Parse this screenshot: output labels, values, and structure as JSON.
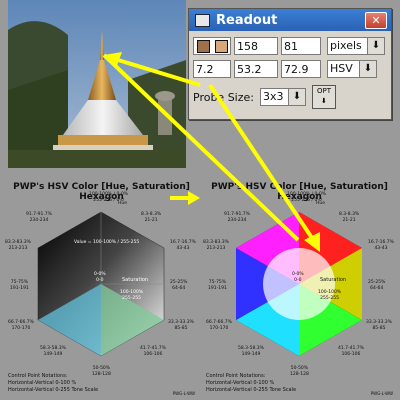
{
  "readout": {
    "title": "Readout",
    "close": "✕",
    "row1": {
      "v1": "158",
      "v2": "81",
      "unit": "pixels"
    },
    "row2": {
      "v1": "7.2",
      "v2": "53.2",
      "v3": "72.9",
      "space": "HSV"
    },
    "probe_label": "Probe Size:",
    "probe_value": "3x3",
    "opt_label": "OPT",
    "swatch_colors": [
      "#a0704a",
      "#d8a878"
    ]
  },
  "panel": {
    "title": "PWP's HSV Color [Hue, Saturation] Hexagon",
    "hue": "Hue",
    "top": "100-100% / 0-0%",
    "top2": "255-255 / 0-0",
    "upper_left": "91.7-91.7%",
    "upper_left2": "234-234",
    "upper_right": "16.7-16.7%",
    "upper_right2": "43-43",
    "top_right": "8.3-8.3%",
    "top_right2": "21-21",
    "left_top": "83.3-83.3%",
    "left_top2": "213-213",
    "left_mid": "75-75%",
    "left_mid2": "191-191",
    "left_low": "66.7-66.7%",
    "left_low2": "170-170",
    "bottom_left": "58.3-58.3%",
    "bottom_left2": "149-149",
    "bottom": "50-50%",
    "bottom2": "128-128",
    "bottom_right": "41.7-41.7%",
    "bottom_right2": "106-106",
    "right_top": "25-25%",
    "right_top2": "64-64",
    "right_low": "33.3-33.3%",
    "right_low2": "85-85",
    "center": "0-0%",
    "center2": "0-0",
    "value": "Value = 100-100% / 255-255",
    "saturation": "Saturation",
    "sat_pct": "100-100%",
    "sat_val": "255-255",
    "notes1": "Control Point Notations:",
    "notes2": "Horizontal-Vertical 0-100 %",
    "notes3": "Horizontal-Vertical 0-255 Tone Scale",
    "tag": "PWG-L-WW"
  },
  "colors": {
    "arrow": "#ffff00",
    "hexagon_bg": "#111111"
  }
}
